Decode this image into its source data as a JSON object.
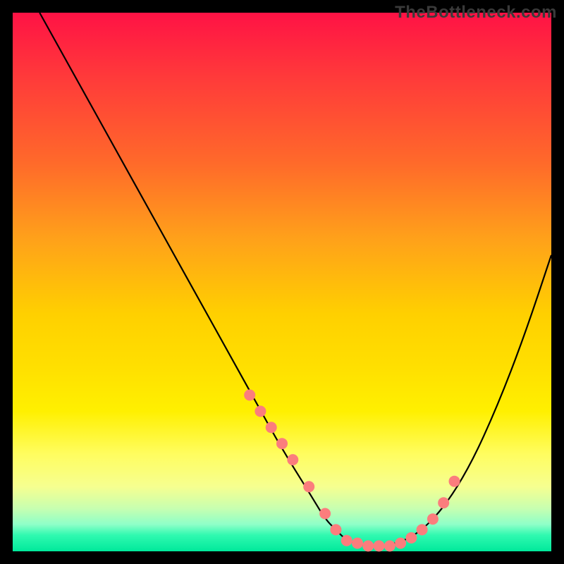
{
  "watermark": "TheBottleneck.com",
  "chart_data": {
    "type": "line",
    "title": "",
    "xlabel": "",
    "ylabel": "",
    "xlim": [
      0,
      100
    ],
    "ylim": [
      0,
      100
    ],
    "grid": false,
    "legend": false,
    "series": [
      {
        "name": "curve",
        "color": "#000000",
        "x": [
          5,
          10,
          15,
          20,
          25,
          30,
          35,
          40,
          45,
          50,
          55,
          58,
          60,
          62,
          65,
          70,
          75,
          80,
          85,
          90,
          95,
          100
        ],
        "y": [
          100,
          91,
          82,
          73,
          64,
          55,
          46,
          37,
          28,
          19,
          11,
          6,
          4,
          2,
          1,
          1,
          3,
          8,
          16,
          27,
          40,
          55
        ]
      }
    ],
    "markers": {
      "name": "highlight-dots",
      "color": "#fb7d7d",
      "x": [
        44,
        46,
        48,
        50,
        52,
        55,
        58,
        60,
        62,
        64,
        66,
        68,
        70,
        72,
        74,
        76,
        78,
        80,
        82
      ],
      "y": [
        29,
        26,
        23,
        20,
        17,
        12,
        7,
        4,
        2,
        1.5,
        1,
        1,
        1,
        1.5,
        2.5,
        4,
        6,
        9,
        13
      ]
    }
  }
}
